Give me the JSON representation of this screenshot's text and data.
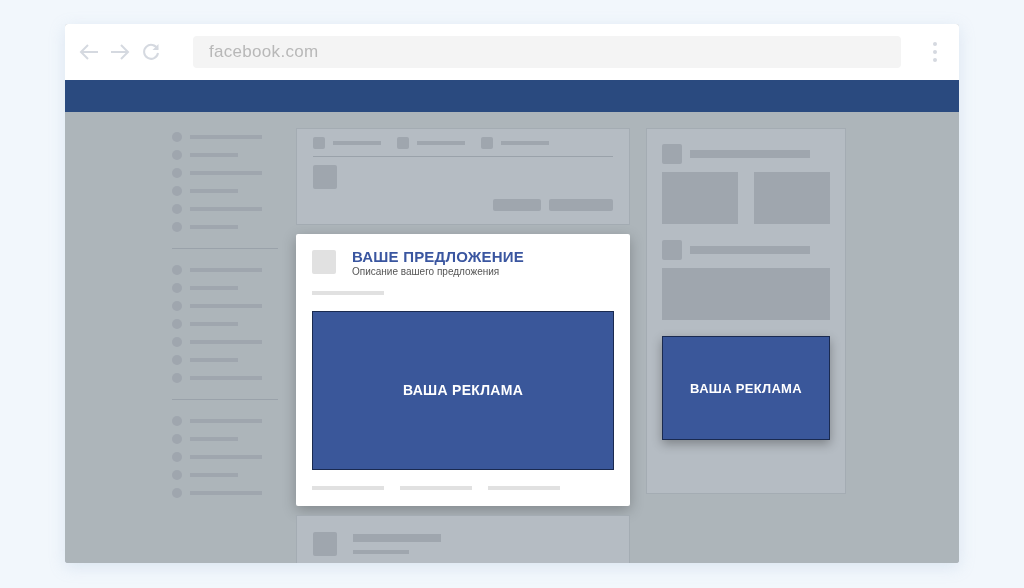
{
  "browser": {
    "url": "facebook.com"
  },
  "feed_ad": {
    "title": "ВАШЕ ПРЕДЛОЖЕНИЕ",
    "description": "Описание вашего предложения",
    "banner": "ВАША РЕКЛАМА"
  },
  "side_ad": {
    "banner": "ВАША РЕКЛАМА"
  }
}
